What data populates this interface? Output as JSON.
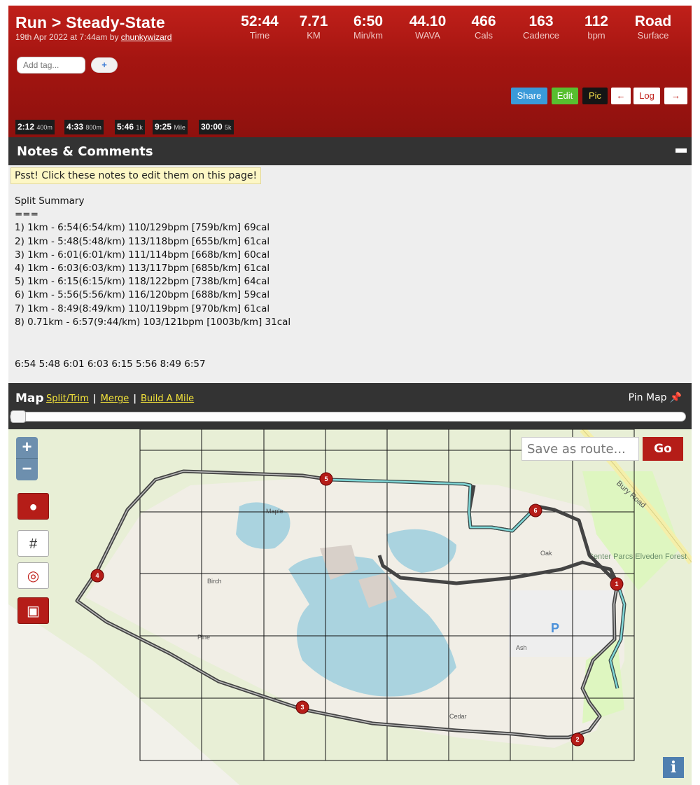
{
  "header": {
    "title": "Run > Steady-State",
    "subtitle_prefix": "19th Apr 2022 at 7:44am by ",
    "author": "chunkywizard",
    "stats": [
      {
        "value": "52:44",
        "label": "Time"
      },
      {
        "value": "7.71",
        "label": "KM"
      },
      {
        "value": "6:50",
        "label": "Min/km"
      },
      {
        "value": "44.10",
        "label": "WAVA"
      },
      {
        "value": "466",
        "label": "Cals"
      },
      {
        "value": "163",
        "label": "Cadence"
      },
      {
        "value": "112",
        "label": "bpm"
      },
      {
        "value": "Road",
        "label": "Surface"
      }
    ],
    "tag_placeholder": "Add tag...",
    "tag_add": "+",
    "buttons": {
      "share": "Share",
      "edit": "Edit",
      "pic": "Pic",
      "prev": "←",
      "log": "Log",
      "next": "→"
    },
    "splits": [
      {
        "time": "2:12",
        "dist": "400m"
      },
      {
        "time": "4:33",
        "dist": "800m"
      },
      {
        "time": "5:46",
        "dist": "1k"
      },
      {
        "time": "9:25",
        "dist": "Mile"
      },
      {
        "time": "30:00",
        "dist": "5k"
      }
    ],
    "colors": {
      "header_red": "#a51511",
      "share_blue": "#3a9ad9",
      "edit_green": "#58bf2f"
    }
  },
  "notes": {
    "title": "Notes & Comments",
    "hint": "Psst! Click these notes to edit them on this page!",
    "heading": "Split Summary",
    "divider": "===",
    "lines": [
      "1) 1km - 6:54(6:54/km) 110/129bpm [759b/km] 69cal",
      "2) 1km - 5:48(5:48/km) 113/118bpm [655b/km] 61cal",
      "3) 1km - 6:01(6:01/km) 111/114bpm [668b/km] 60cal",
      "4) 1km - 6:03(6:03/km) 113/117bpm [685b/km] 61cal",
      "5) 1km - 6:15(6:15/km) 118/122bpm [738b/km] 64cal",
      "6) 1km - 5:56(5:56/km) 116/120bpm [688b/km] 59cal",
      "7) 1km - 8:49(8:49/km) 110/119bpm [970b/km] 61cal",
      "8) 0.71km - 6:57(9:44/km) 103/121bpm [1003b/km] 31cal"
    ],
    "paces": "6:54 5:48 6:01 6:03 6:15 5:56 8:49 6:57"
  },
  "map": {
    "title": "Map",
    "links": [
      "Split/Trim",
      "Merge",
      "Build A Mile"
    ],
    "pin_label": "Pin Map",
    "route_placeholder": "Save as route...",
    "go_label": "Go",
    "zoom_in": "+",
    "zoom_out": "−",
    "info": "i",
    "slider_value": 0,
    "markers": [
      "1",
      "2",
      "3",
      "4",
      "5",
      "6"
    ],
    "road_label": "Bury Road",
    "poi_label": "Center Parcs Elveden Forest",
    "street_labels": [
      "Maple",
      "Birch",
      "Pine",
      "Oak",
      "Ash",
      "Cedar"
    ],
    "parking": "P"
  }
}
